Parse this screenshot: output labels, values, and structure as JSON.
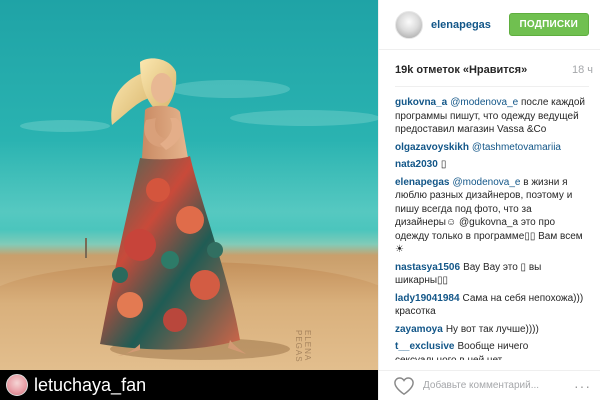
{
  "post": {
    "photo_alt": "Woman in floral maxi skirt on sand dunes",
    "photo_user": "letuchaya_fan",
    "watermark": "ELENA PEGAS"
  },
  "header": {
    "username": "elenapegas",
    "follow_label": "ПОДПИСКИ"
  },
  "stats": {
    "likes": "19k отметок «Нравится»",
    "time": "18 ч"
  },
  "comments": [
    {
      "author": "gukovna_a",
      "mention": "@modenova_e",
      "text": " после каждой программы пишут, что одежду ведущей предоставил магазин Vassa &Co"
    },
    {
      "author": "olgazavoyskikh",
      "mention": "@tashmetovamariia",
      "text": ""
    },
    {
      "author": "nata2030",
      "mention": "",
      "text": "▯"
    },
    {
      "author": "elenapegas",
      "mention": "@modenova_e",
      "text": " в жизни я люблю разных дизайнеров, поэтому и пишу всегда под фото, что за дизайнеры☺ @gukovna_a это про одежду только в программе▯▯ Вам всем ☀"
    },
    {
      "author": "nastasya1506",
      "mention": "",
      "text": "Вау Вау это ▯ вы шикарны▯▯"
    },
    {
      "author": "lady19041984",
      "mention": "",
      "text": "Сама на себя непохожа))) красотка"
    },
    {
      "author": "zayamoya",
      "mention": "",
      "text": "Ну вот так лучше))))"
    },
    {
      "author": "t__exclusive",
      "mention": "",
      "text": "Вообще ничего сексуального в ней нет"
    }
  ],
  "footer": {
    "comment_placeholder": "Добавьте комментарий...",
    "more_label": "···"
  },
  "icons": {
    "heart": "heart-outline-icon",
    "more": "more-options-icon"
  },
  "colors": {
    "follow_green": "#70c050",
    "link_blue": "#125688",
    "muted": "#a5a7aa"
  }
}
